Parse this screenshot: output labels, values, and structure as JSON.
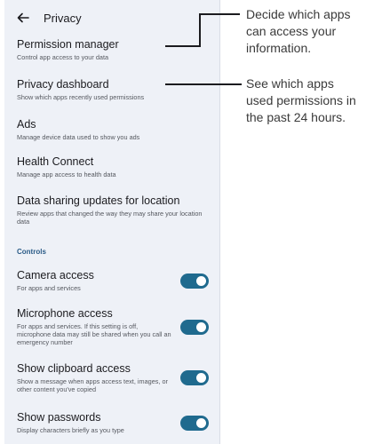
{
  "header": {
    "title": "Privacy"
  },
  "items": [
    {
      "title": "Permission manager",
      "subtitle": "Control app access to your data"
    },
    {
      "title": "Privacy dashboard",
      "subtitle": "Show which apps recently used permissions"
    },
    {
      "title": "Ads",
      "subtitle": "Manage device data used to show you ads"
    },
    {
      "title": "Health Connect",
      "subtitle": "Manage app access to health data"
    },
    {
      "title": "Data sharing updates for location",
      "subtitle": "Review apps that changed the way they may share your location data"
    }
  ],
  "controls": {
    "header": "Controls",
    "toggles": [
      {
        "title": "Camera access",
        "subtitle": "For apps and services",
        "on": true
      },
      {
        "title": "Microphone access",
        "subtitle": "For apps and services. If this setting is off, microphone data may still be shared when you call an emergency number",
        "on": true
      },
      {
        "title": "Show clipboard access",
        "subtitle": "Show a message when apps access text, images, or other content you've copied",
        "on": true
      },
      {
        "title": "Show passwords",
        "subtitle": "Display characters briefly as you type",
        "on": true
      }
    ]
  },
  "callouts": [
    {
      "text": "Decide which apps can access your information."
    },
    {
      "text": "See which apps used permissions in the past 24 hours."
    }
  ],
  "colors": {
    "accent": "#1f6a8e",
    "background": "#eef1f7",
    "section_header": "#2a5b87"
  }
}
